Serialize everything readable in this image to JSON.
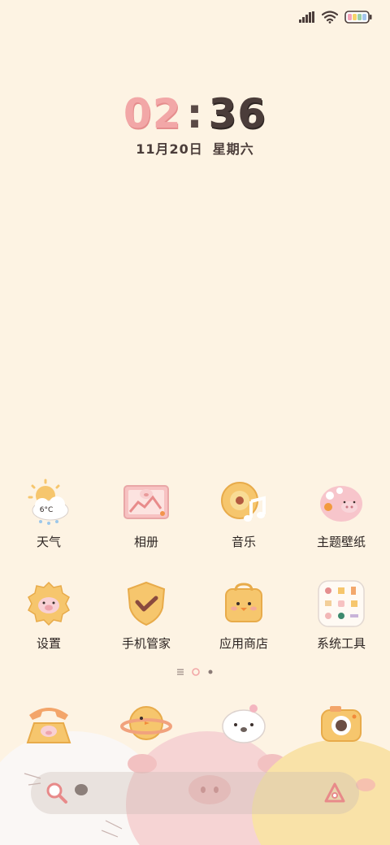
{
  "status_bar": {
    "signal_icon": "cellular-signal-icon",
    "wifi_icon": "wifi-icon",
    "battery_icon": "battery-icon"
  },
  "clock": {
    "hour": "02",
    "separator": ":",
    "minute": "36",
    "date": "11月20日",
    "weekday": "星期六"
  },
  "weather_widget": {
    "temperature": "6°C"
  },
  "apps_row1": [
    {
      "label": "天气",
      "icon": "weather-icon"
    },
    {
      "label": "相册",
      "icon": "gallery-icon"
    },
    {
      "label": "音乐",
      "icon": "music-icon"
    },
    {
      "label": "主题壁纸",
      "icon": "themes-icon"
    }
  ],
  "apps_row2": [
    {
      "label": "设置",
      "icon": "settings-icon"
    },
    {
      "label": "手机管家",
      "icon": "security-icon"
    },
    {
      "label": "应用商店",
      "icon": "app-store-icon"
    },
    {
      "label": "系统工具",
      "icon": "system-tools-icon"
    }
  ],
  "dock": [
    {
      "icon": "phone-icon"
    },
    {
      "icon": "planet-browser-icon"
    },
    {
      "icon": "seal-messages-icon"
    },
    {
      "icon": "camera-icon"
    }
  ],
  "page_indicator": {
    "pages": 3,
    "current": 2
  },
  "search_bar": {
    "search_icon": "search-icon",
    "assistant_icon": "assistant-icon"
  },
  "colors": {
    "background": "#fdf3e3",
    "pink": "#f2a7a7",
    "dark": "#4b3d3a",
    "yellow": "#f6c66d"
  }
}
